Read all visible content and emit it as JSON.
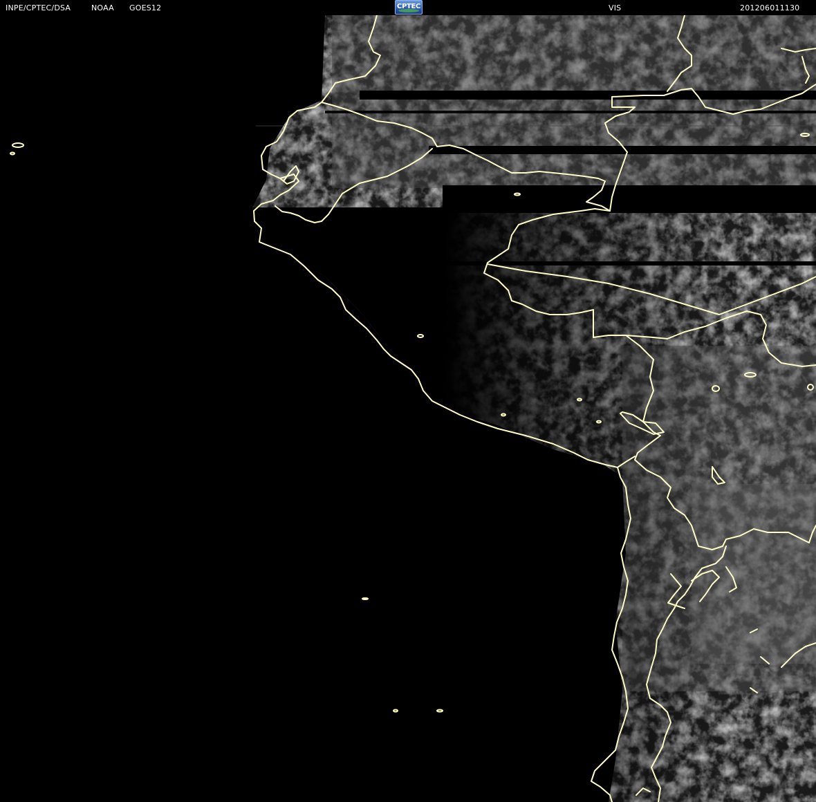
{
  "header": {
    "source": "INPE/CPTEC/DSA",
    "agency": "NOAA",
    "satellite": "GOES12",
    "channel": "VIS",
    "timestamp": "201206011130"
  },
  "logo": {
    "text": "CPTEC"
  },
  "colors": {
    "background": "#000000",
    "header_text": "#ffffff",
    "border_lines": "#fffcc8",
    "cloud_gray": "#6a6a6a",
    "land_gray": "#3a3a3a"
  }
}
